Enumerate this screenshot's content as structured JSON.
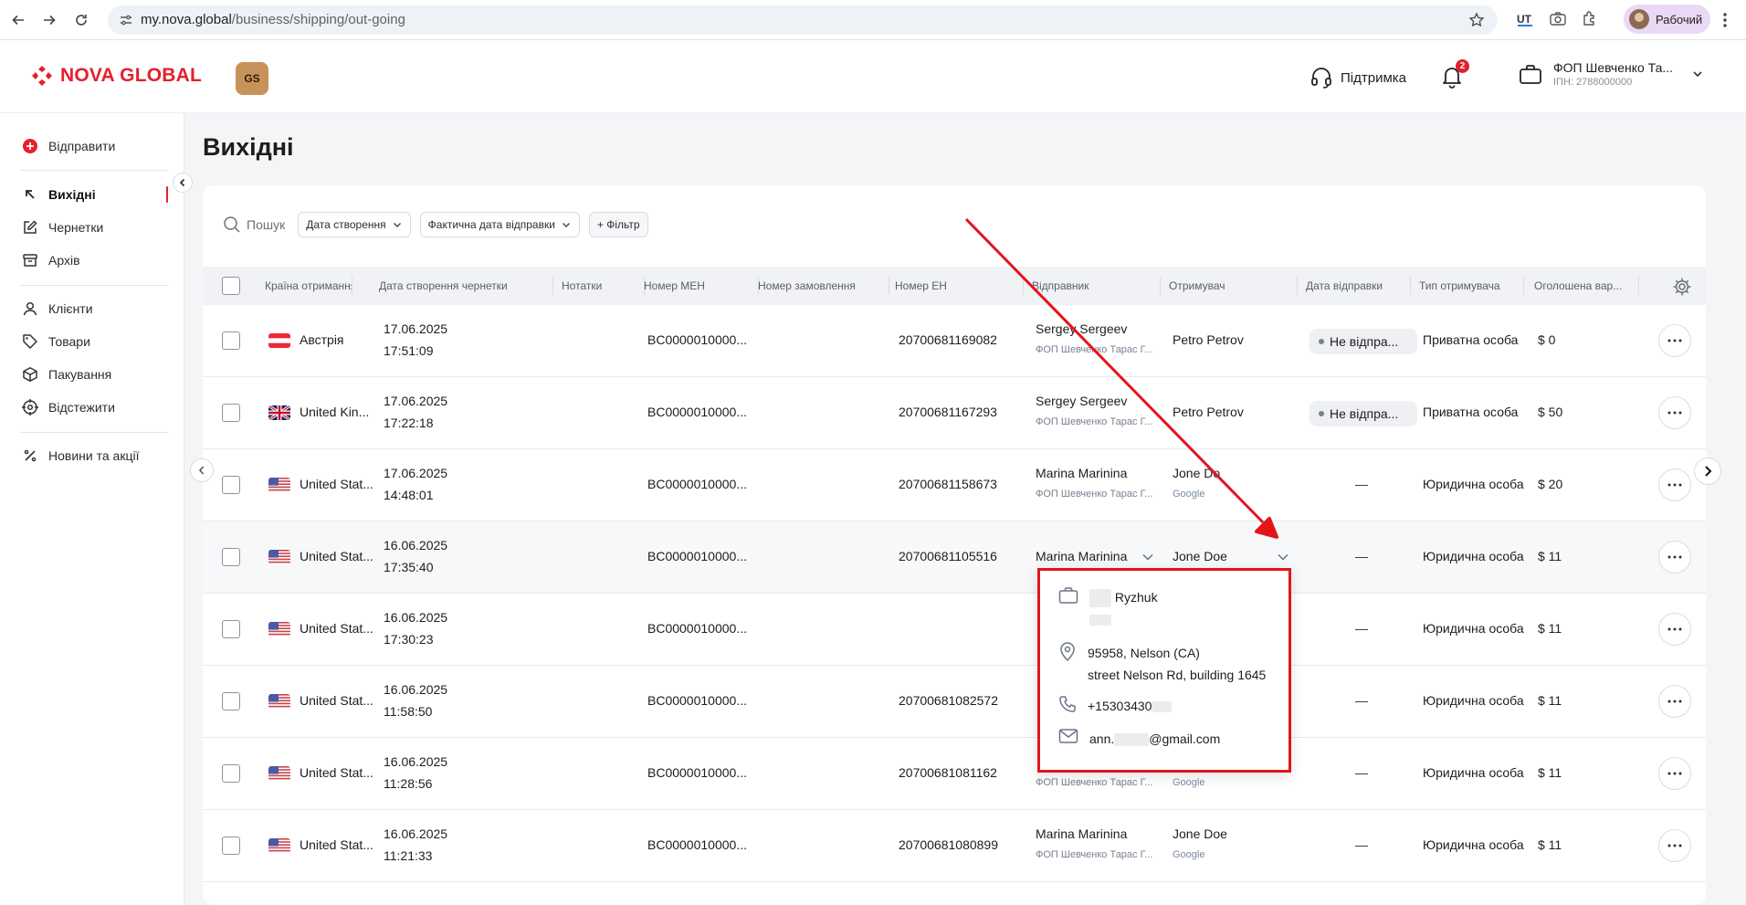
{
  "browser": {
    "url_host": "my.nova.global",
    "url_path": "/business/shipping/out-going",
    "profile_label": "Рабочий"
  },
  "header": {
    "logo_text": "NOVA GLOBAL",
    "badge_text": "GS",
    "support_label": "Підтримка",
    "notifications_count": "2",
    "account_name": "ФОП Шевченко Та...",
    "account_inn": "ІПН: 2788000000"
  },
  "sidebar": {
    "send": "Відправити",
    "outgoing": "Вихідні",
    "drafts": "Чернетки",
    "archive": "Архів",
    "clients": "Клієнти",
    "goods": "Товари",
    "packing": "Пакування",
    "tracking": "Відстежити",
    "news": "Новини та акції"
  },
  "page": {
    "title": "Вихідні",
    "search_label": "Пошук",
    "filter_created": "Дата створення",
    "filter_actual": "Фактична дата відправки",
    "filter_add": "+ Фільтр"
  },
  "columns": {
    "country": "Країна отримання",
    "draft_date": "Дата створення чернетки",
    "notes": "Нотатки",
    "men": "Номер MEH",
    "order": "Номер замовлення",
    "en": "Номер ЕН",
    "sender": "Відправник",
    "recipient": "Отримувач",
    "ship_date": "Дата відправки",
    "recipient_type": "Тип отримувача",
    "declared": "Оголошена вар..."
  },
  "rows": [
    {
      "country": "Австрія",
      "flag": "at",
      "date": "17.06.2025",
      "time": "17:51:09",
      "men": "BC0000010000...",
      "en": "20700681169082",
      "sender": "Sergey Sergeev",
      "sender_org": "ФОП Шевченко Тарас Г...",
      "recipient": "Petro Petrov",
      "recipient_org": "",
      "ship": "Не відпра...",
      "type": "Приватна особа",
      "declared": "$ 0"
    },
    {
      "country": "United Kin...",
      "flag": "gb",
      "date": "17.06.2025",
      "time": "17:22:18",
      "men": "BC0000010000...",
      "en": "20700681167293",
      "sender": "Sergey Sergeev",
      "sender_org": "ФОП Шевченко Тарас Г...",
      "recipient": "Petro Petrov",
      "recipient_org": "",
      "ship": "Не відпра...",
      "type": "Приватна особа",
      "declared": "$ 50"
    },
    {
      "country": "United Stat...",
      "flag": "us",
      "date": "17.06.2025",
      "time": "14:48:01",
      "men": "BC0000010000...",
      "en": "20700681158673",
      "sender": "Marina Marinina",
      "sender_org": "ФОП Шевченко Тарас Г...",
      "recipient": "Jone Do",
      "recipient_org": "Google",
      "ship": "—",
      "type": "Юридична особа",
      "declared": "$ 20"
    },
    {
      "country": "United Stat...",
      "flag": "us",
      "date": "16.06.2025",
      "time": "17:35:40",
      "men": "BC0000010000...",
      "en": "20700681105516",
      "sender": "Marina Marinina",
      "sender_org": "",
      "recipient": "Jone Doe",
      "recipient_org": "",
      "ship": "—",
      "type": "Юридична особа",
      "declared": "$ 11"
    },
    {
      "country": "United Stat...",
      "flag": "us",
      "date": "16.06.2025",
      "time": "17:30:23",
      "men": "BC0000010000...",
      "en": "",
      "sender": "",
      "sender_org": "",
      "recipient": "",
      "recipient_org": "",
      "ship": "—",
      "type": "Юридична особа",
      "declared": "$ 11"
    },
    {
      "country": "United Stat...",
      "flag": "us",
      "date": "16.06.2025",
      "time": "11:58:50",
      "men": "BC0000010000...",
      "en": "20700681082572",
      "sender": "",
      "sender_org": "",
      "recipient": "",
      "recipient_org": "",
      "ship": "—",
      "type": "Юридична особа",
      "declared": "$ 11"
    },
    {
      "country": "United Stat...",
      "flag": "us",
      "date": "16.06.2025",
      "time": "11:28:56",
      "men": "BC0000010000...",
      "en": "20700681081162",
      "sender": "",
      "sender_org": "ФОП Шевченко Тарас Г...",
      "recipient": "",
      "recipient_org": "Google",
      "ship": "—",
      "type": "Юридична особа",
      "declared": "$ 11"
    },
    {
      "country": "United Stat...",
      "flag": "us",
      "date": "16.06.2025",
      "time": "11:21:33",
      "men": "BC0000010000...",
      "en": "20700681080899",
      "sender": "Marina Marinina",
      "sender_org": "ФОП Шевченко Тарас Г...",
      "recipient": "Jone Doe",
      "recipient_org": "Google",
      "ship": "—",
      "type": "Юридична особа",
      "declared": "$ 11"
    }
  ],
  "popup": {
    "name": "Ryzhuk",
    "address_line1": "95958, Nelson (CA)",
    "address_line2": "street Nelson Rd, building 1645",
    "phone": "+15303430",
    "email_prefix": "ann.",
    "email_suffix": "@gmail.com"
  },
  "colors": {
    "brand_red": "#e5202e",
    "annotation_red": "#e4141b"
  }
}
